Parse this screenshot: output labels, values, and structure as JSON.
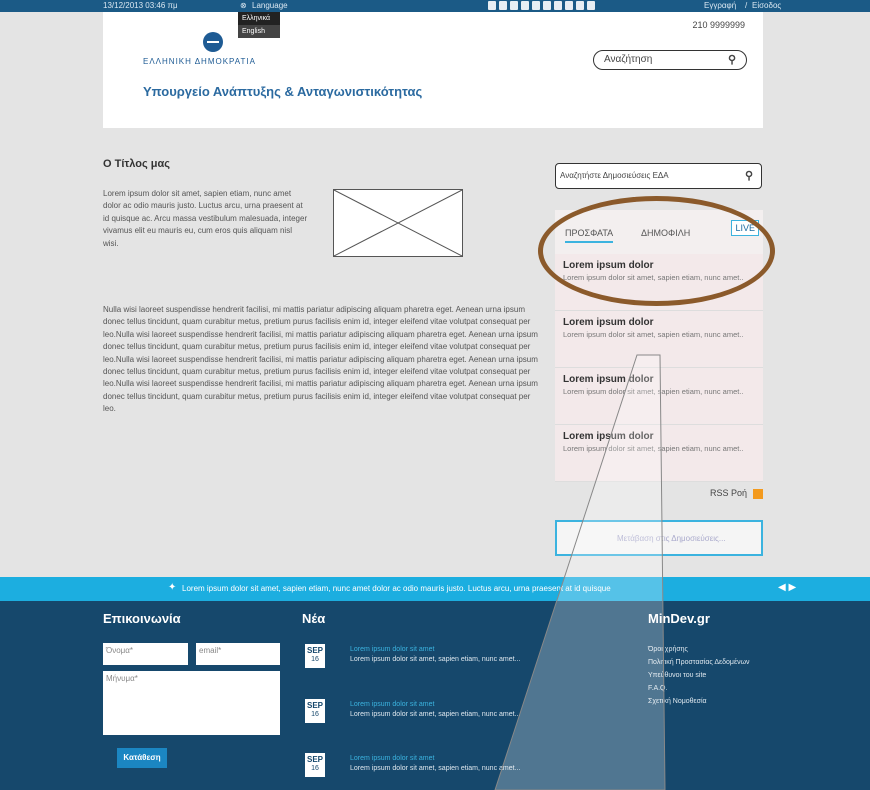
{
  "topbar": {
    "datetime": "13/12/2013 03:46 πμ",
    "language_label": "Language",
    "register_label": "Εγγραφή",
    "sep": "/",
    "login_label": "Είσοδος"
  },
  "language_menu": {
    "greek": "Ελληνικά",
    "english": "English"
  },
  "header": {
    "gov": "ΕΛΛΗΝΙΚΗ ΔΗΜΟΚΡΑΤΙΑ",
    "ministry": "Υπουργείο Ανάπτυξης & Ανταγωνιστικότητας",
    "phone": "210 9999999",
    "search_placeholder": "Αναζήτηση"
  },
  "article": {
    "title": "Ο Τίτλος μας",
    "p1": "Lorem ipsum dolor sit amet, sapien etiam, nunc amet dolor ac odio mauris justo. Luctus arcu, urna praesent at id quisque ac. Arcu massa vestibulum malesuada, integer vivamus elit eu mauris eu, cum eros quis aliquam nisl wisi.",
    "p2": "Nulla wisi laoreet suspendisse hendrerit facilisi, mi mattis pariatur adipiscing aliquam pharetra eget. Aenean urna ipsum donec tellus tincidunt, quam curabitur metus, pretium purus facilisis enim id, integer eleifend vitae volutpat consequat per leo.Nulla wisi laoreet suspendisse hendrerit facilisi, mi mattis pariatur adipiscing aliquam pharetra eget. Aenean urna ipsum donec tellus tincidunt, quam curabitur metus, pretium purus facilisis enim id, integer eleifend vitae volutpat consequat per leo.Nulla wisi laoreet suspendisse hendrerit facilisi, mi mattis pariatur adipiscing aliquam pharetra eget. Aenean urna ipsum donec tellus tincidunt, quam curabitur metus, pretium purus facilisis enim id, integer eleifend vitae volutpat consequat per leo.Nulla wisi laoreet suspendisse hendrerit facilisi, mi mattis pariatur adipiscing aliquam pharetra eget. Aenean urna ipsum donec tellus tincidunt, quam curabitur metus, pretium purus facilisis enim id, integer eleifend vitae volutpat consequat per leo."
  },
  "sidebar": {
    "deliberation_search": "Αναζητήστε Δημοσιεύσεις ΕΔΑ",
    "tabs": [
      "ΠΡΟΣΦΑΤΑ",
      "ΔΗΜΟΦΙΛΗ",
      "LIVE"
    ],
    "news": [
      {
        "title": "Lorem ipsum dolor",
        "text": "Lorem ipsum dolor sit amet, sapien etiam, nunc amet.."
      },
      {
        "title": "Lorem ipsum dolor",
        "text": "Lorem ipsum dolor sit amet, sapien etiam, nunc amet.."
      },
      {
        "title": "Lorem ipsum dolor",
        "text": "Lorem ipsum dolor sit amet, sapien etiam, nunc amet.."
      },
      {
        "title": "Lorem ipsum dolor",
        "text": "Lorem ipsum dolor sit amet, sapien etiam, nunc amet.."
      }
    ],
    "rss_label": "RSS Ροή",
    "more_label": "Μετάβαση στις Δημοσιεύσεις..."
  },
  "ticker": {
    "text": "Lorem ipsum dolor sit amet, sapien etiam, nunc amet dolor ac odio mauris justo. Luctus arcu, urna praesent at id quisque"
  },
  "footer": {
    "contact_title": "Επικοινωνία",
    "name_placeholder": "Όνομα*",
    "email_placeholder": "email*",
    "message_placeholder": "Μήνυμα*",
    "submit_label": "Κατάθεση",
    "news_title": "Νέα",
    "news_items": [
      {
        "month": "SEP",
        "day": "16",
        "title": "Lorem ipsum dolor sit amet",
        "text": "Lorem ipsum dolor sit amet, sapien etiam, nunc amet..."
      },
      {
        "month": "SEP",
        "day": "16",
        "title": "Lorem ipsum dolor sit amet",
        "text": "Lorem ipsum dolor sit amet, sapien etiam, nunc amet..."
      },
      {
        "month": "SEP",
        "day": "16",
        "title": "Lorem ipsum dolor sit amet",
        "text": "Lorem ipsum dolor sit amet, sapien etiam, nunc amet..."
      }
    ],
    "site_title": "MinDev.gr",
    "links": [
      "Όροι χρήσης",
      "Πολιτική Προστασίας Δεδομένων",
      "Υπεύθυνοι του site",
      "F.A.Q.",
      "Σχετική Νομοθεσία"
    ]
  },
  "colors": {
    "brand_blue": "#1e5b94",
    "ticker": "#1caee0",
    "footer": "#16486c",
    "ring": "#8b5a2b"
  },
  "icons": [
    "globe-icon",
    "seal-icon",
    "search-icon",
    "twitter-icon",
    "rss-icon",
    "prev-arrow-icon",
    "next-arrow-icon"
  ]
}
